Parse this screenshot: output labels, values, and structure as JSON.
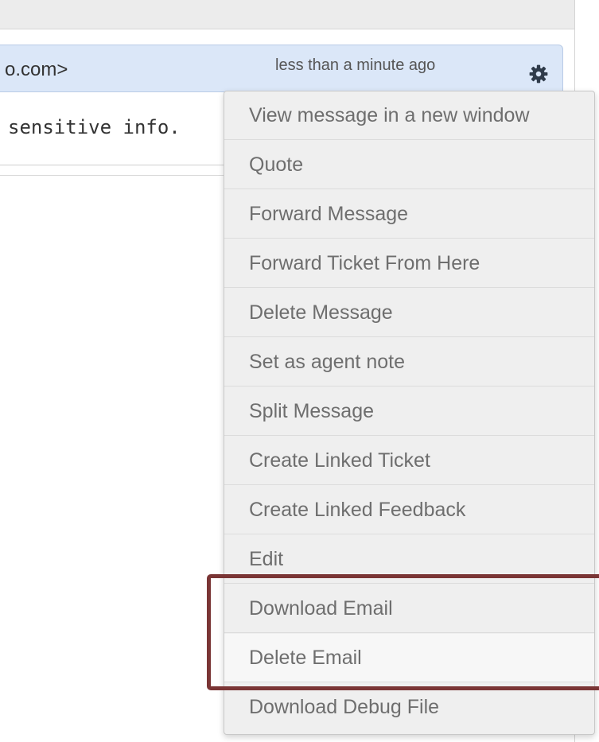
{
  "message": {
    "sender_fragment": "o.com>",
    "timestamp": "less than a minute ago",
    "body_fragment": "sensitive info."
  },
  "icons": {
    "settings": "gear-icon"
  },
  "menu": {
    "items": [
      {
        "label": "View message in a new window"
      },
      {
        "label": "Quote"
      },
      {
        "label": "Forward Message"
      },
      {
        "label": "Forward Ticket From Here"
      },
      {
        "label": "Delete Message"
      },
      {
        "label": "Set as agent note"
      },
      {
        "label": "Split Message"
      },
      {
        "label": "Create Linked Ticket"
      },
      {
        "label": "Create Linked Feedback"
      },
      {
        "label": "Edit"
      },
      {
        "label": "Download Email"
      },
      {
        "label": "Delete Email"
      },
      {
        "label": "Download Debug File"
      }
    ]
  },
  "colors": {
    "header_background": "#dbe7f8",
    "menu_background": "#efefef",
    "highlight_box": "#7a3535",
    "menu_text": "#6e6e6e"
  }
}
